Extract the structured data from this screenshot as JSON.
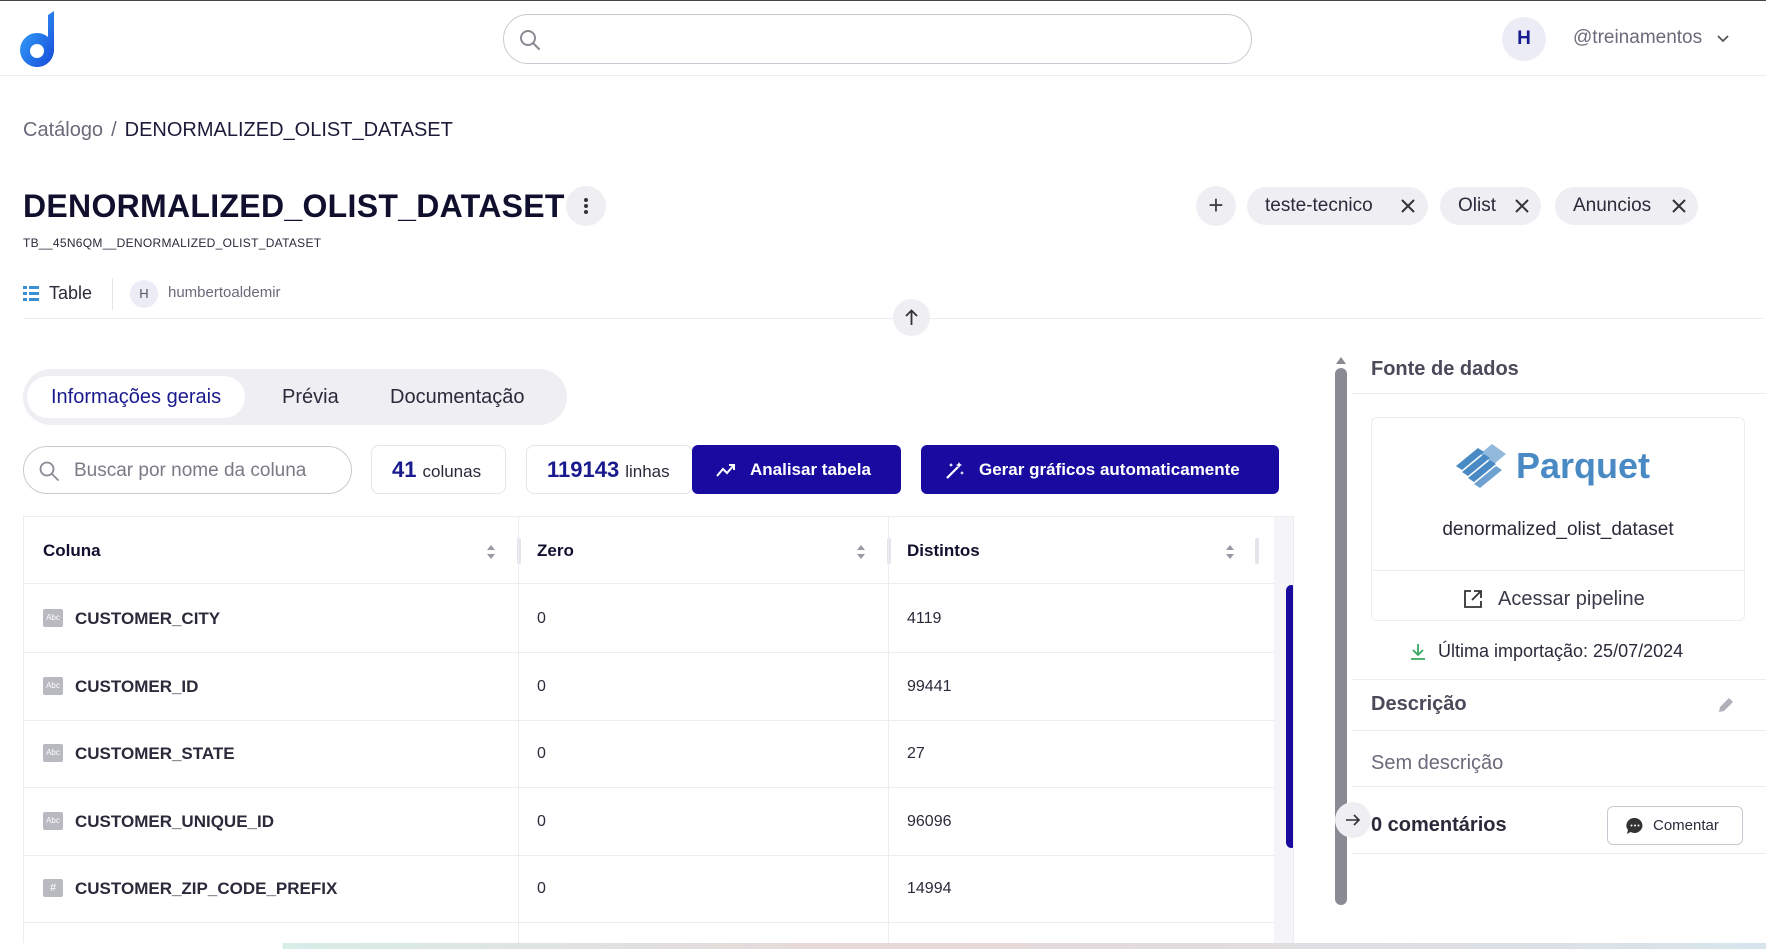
{
  "header": {
    "search_placeholder": "",
    "avatar_initial": "H",
    "username": "@treinamentos"
  },
  "breadcrumb": {
    "root": "Catálogo",
    "separator": "/",
    "current": "DENORMALIZED_OLIST_DATASET"
  },
  "dataset": {
    "title": "DENORMALIZED_OLIST_DATASET",
    "technical_name": "TB__45N6QM__DENORMALIZED_OLIST_DATASET",
    "type": "Table",
    "owner_initial": "H",
    "owner": "humbertoaldemir"
  },
  "tags": [
    "teste-tecnico",
    "Olist",
    "Anuncios"
  ],
  "tabs": [
    {
      "label": "Informações gerais",
      "active": true
    },
    {
      "label": "Prévia",
      "active": false
    },
    {
      "label": "Documentação",
      "active": false
    }
  ],
  "toolbar": {
    "column_search_placeholder": "Buscar por nome da coluna",
    "columns_count": "41",
    "columns_label": "colunas",
    "rows_count": "119143",
    "rows_label": "linhas",
    "analyze_label": "Analisar tabela",
    "charts_label": "Gerar gráficos automaticamente"
  },
  "table": {
    "headers": [
      "Coluna",
      "Zero",
      "Distintos"
    ],
    "rows": [
      {
        "type_icon": "Abc",
        "name": "CUSTOMER_CITY",
        "zero": "0",
        "distinct": "4119"
      },
      {
        "type_icon": "Abc",
        "name": "CUSTOMER_ID",
        "zero": "0",
        "distinct": "99441"
      },
      {
        "type_icon": "Abc",
        "name": "CUSTOMER_STATE",
        "zero": "0",
        "distinct": "27"
      },
      {
        "type_icon": "Abc",
        "name": "CUSTOMER_UNIQUE_ID",
        "zero": "0",
        "distinct": "96096"
      },
      {
        "type_icon": "#",
        "name": "CUSTOMER_ZIP_CODE_PREFIX",
        "zero": "0",
        "distinct": "14994"
      }
    ]
  },
  "panel": {
    "source_title": "Fonte de dados",
    "source_logo_text": "Parquet",
    "source_name": "denormalized_olist_dataset",
    "pipeline_label": "Acessar pipeline",
    "last_import": "Última importação: 25/07/2024",
    "description_title": "Descrição",
    "description_text": "Sem descrição",
    "comments_title": "0 comentários",
    "comment_button": "Comentar"
  },
  "colors": {
    "primary": "#1a0ba0",
    "accent_blue": "#3a8fd0",
    "logo_blue": "#1a6fe0",
    "parquet_blue": "#4a8ac4",
    "success_green": "#3aa860"
  }
}
